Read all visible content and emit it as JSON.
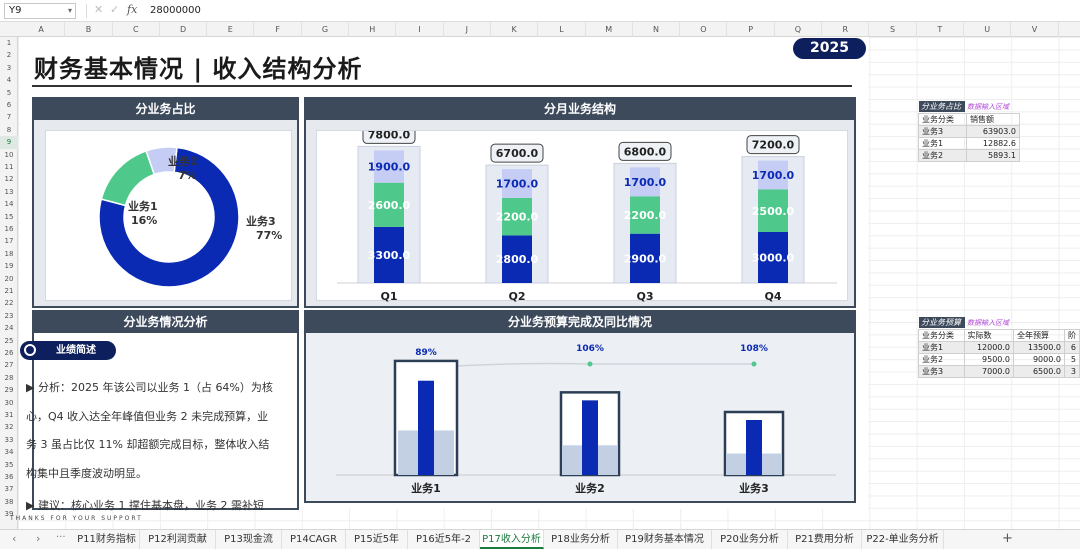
{
  "formula_bar": {
    "cell_ref": "Y9",
    "formula_value": "28000000",
    "fx_label": "fx",
    "cancel_glyph": "✕",
    "confirm_glyph": "✓"
  },
  "columns": [
    "A",
    "B",
    "C",
    "D",
    "E",
    "F",
    "G",
    "H",
    "I",
    "J",
    "K",
    "L",
    "M",
    "N",
    "O",
    "P",
    "Q",
    "R",
    "S",
    "T",
    "U",
    "V"
  ],
  "active_column": "Y",
  "rows": [
    "1",
    "2",
    "3",
    "4",
    "5",
    "6",
    "7",
    "8",
    "9",
    "10",
    "11",
    "12",
    "13",
    "14",
    "15",
    "16",
    "17",
    "18",
    "19",
    "20",
    "21",
    "22",
    "23",
    "24",
    "25",
    "26",
    "27",
    "28",
    "29",
    "30",
    "31",
    "32",
    "33",
    "34",
    "35",
    "36",
    "37",
    "38",
    "39"
  ],
  "active_row": "9",
  "dashboard": {
    "title": "财务基本情况 | 收入结构分析",
    "year": "2025",
    "panels": {
      "share": "分业务占比",
      "monthly": "分月业务结构",
      "analysis": "分业务情况分析",
      "budget": "分业务预算完成及同比情况"
    },
    "analysis": {
      "pill_label": "业绩简述",
      "paragraph": "▶ 分析：2025 年该公司以业务 1（占 64%）为核心，Q4 收入达全年峰值但业务 2 未完成预算，业务 3 虽占比仅 11% 却超额完成目标，整体收入结构集中且季度波动明显。",
      "paragraph2": "▶ 建议：核心业务 1 撑住基本盘，业务 2 需补短",
      "thanks": "THANKS FOR YOUR SUPPORT"
    }
  },
  "chart_data": [
    {
      "type": "pie",
      "title": "分业务占比",
      "donut": true,
      "labels": [
        "业务3",
        "业务1",
        "业务2"
      ],
      "values": [
        63903.0,
        12882.6,
        5893.1
      ],
      "display_labels": [
        {
          "name": "业务3",
          "pct": "77%"
        },
        {
          "name": "业务1",
          "pct": "16%"
        },
        {
          "name": "业务2",
          "pct": "7%"
        }
      ],
      "colors": [
        "#0b2ab3",
        "#4ec98b",
        "#c5cdf5"
      ]
    },
    {
      "type": "bar",
      "stacked": true,
      "title": "分月业务结构",
      "categories": [
        "Q1",
        "Q2",
        "Q3",
        "Q4"
      ],
      "series": [
        {
          "values": [
            3300.0,
            2800.0,
            2900.0,
            3000.0
          ],
          "color": "#0b2ab3"
        },
        {
          "values": [
            2600.0,
            2200.0,
            2200.0,
            2500.0
          ],
          "color": "#4ec98b"
        },
        {
          "values": [
            1900.0,
            1700.0,
            1700.0,
            1700.0
          ],
          "color": "#c5cdf5"
        }
      ],
      "totals": [
        "7800.0",
        "6700.0",
        "6800.0",
        "7200.0"
      ]
    },
    {
      "type": "bar",
      "title": "分业务预算完成及同比情况",
      "categories": [
        "业务1",
        "业务2",
        "业务3"
      ],
      "series": [
        {
          "name": "实际数",
          "values": [
            12000.0,
            9500.0,
            7000.0
          ],
          "color": "#0b2ab3"
        },
        {
          "name": "全年预算",
          "values": [
            13500.0,
            9000.0,
            6500.0
          ],
          "color": "#c3d0e3"
        }
      ],
      "completion_pct": [
        "89%",
        "106%",
        "108%"
      ]
    }
  ],
  "side_tables": {
    "share": {
      "title": "分业务占比",
      "note": "数据输入区域",
      "headers": [
        "业务分类",
        "销售额"
      ],
      "rows": [
        [
          "业务3",
          "63903.0"
        ],
        [
          "业务1",
          "12882.6"
        ],
        [
          "业务2",
          "5893.1"
        ]
      ]
    },
    "budget": {
      "title": "分业务预算",
      "note": "数据输入区域",
      "headers": [
        "业务分类",
        "实际数",
        "全年预算",
        "阶"
      ],
      "rows": [
        [
          "业务1",
          "12000.0",
          "13500.0",
          "6"
        ],
        [
          "业务2",
          "9500.0",
          "9000.0",
          "5"
        ],
        [
          "业务3",
          "7000.0",
          "6500.0",
          "3"
        ]
      ]
    }
  },
  "tabs": {
    "more": "···",
    "items": [
      "P11财务指标",
      "P12利润贡献",
      "P13现金流",
      "P14CAGR",
      "P15近5年",
      "P16近5年-2",
      "P17收入分析",
      "P18业务分析",
      "P19财务基本情况",
      "P20业务分析",
      "P21费用分析",
      "P22-单业务分析"
    ],
    "active": "P17收入分析",
    "add": "+"
  }
}
